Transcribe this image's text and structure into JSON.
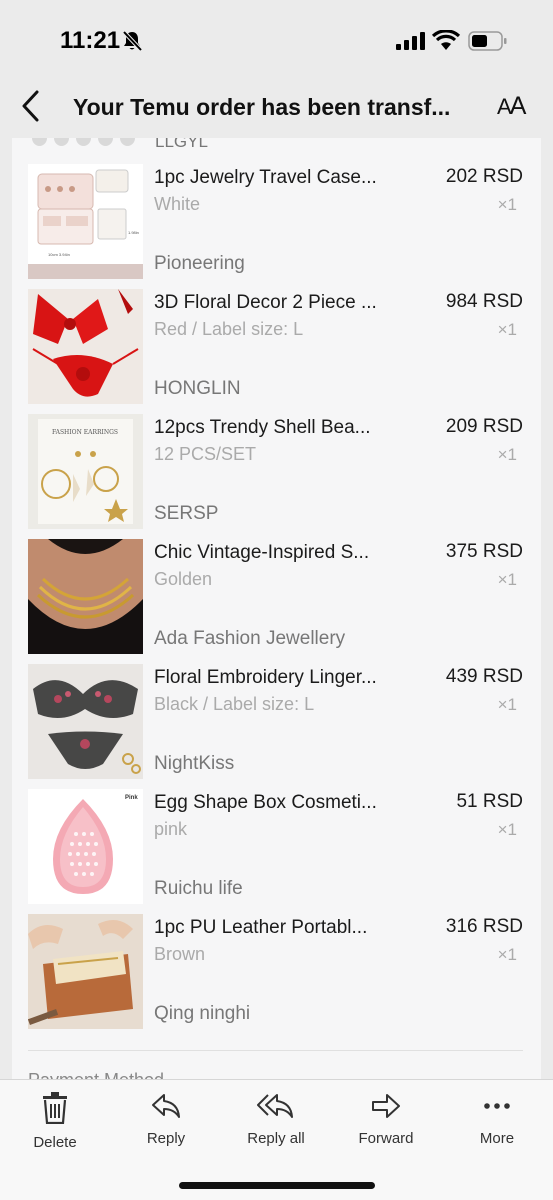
{
  "status_bar": {
    "time": "11:21",
    "icons": [
      "bell-slash-icon",
      "signal-icon",
      "wifi-icon",
      "battery-icon"
    ]
  },
  "nav": {
    "title": "Your Temu order has been transf...",
    "text_size_small": "A",
    "text_size_large": "A"
  },
  "partial_store": "LLGYL",
  "items": [
    {
      "name": "1pc Jewelry Travel Case...",
      "variant": "White",
      "price": "202 RSD",
      "qty": "×1",
      "store": "Pioneering",
      "image_icon": "jewelry-case-image"
    },
    {
      "name": "3D Floral Decor 2 Piece ...",
      "variant": "Red / Label size: L",
      "price": "984 RSD",
      "qty": "×1",
      "store": "HONGLIN",
      "image_icon": "red-bikini-image"
    },
    {
      "name": "12pcs Trendy Shell Bea...",
      "variant": "12 PCS/SET",
      "price": "209 RSD",
      "qty": "×1",
      "store": "SERSP",
      "image_icon": "earrings-card-image",
      "image_text": "FASHION EARRINGS"
    },
    {
      "name": "Chic Vintage-Inspired S...",
      "variant": "Golden",
      "price": "375 RSD",
      "qty": "×1",
      "store": "Ada Fashion Jewellery",
      "image_icon": "gold-necklace-image"
    },
    {
      "name": "Floral Embroidery Linger...",
      "variant": "Black / Label size: L",
      "price": "439 RSD",
      "qty": "×1",
      "store": "NightKiss",
      "image_icon": "lingerie-image"
    },
    {
      "name": "Egg Shape Box Cosmeti...",
      "variant": "pink",
      "price": "51 RSD",
      "qty": "×1",
      "store": "Ruichu life",
      "image_icon": "pink-sponge-image",
      "image_text": "Pink"
    },
    {
      "name": "1pc PU Leather Portabl...",
      "variant": "Brown",
      "price": "316 RSD",
      "qty": "×1",
      "store": "Qing ninghi",
      "image_icon": "leather-bag-image"
    }
  ],
  "partial_section": "Payment Method",
  "toolbar": {
    "delete": "Delete",
    "reply": "Reply",
    "reply_all": "Reply all",
    "forward": "Forward",
    "more": "More"
  }
}
